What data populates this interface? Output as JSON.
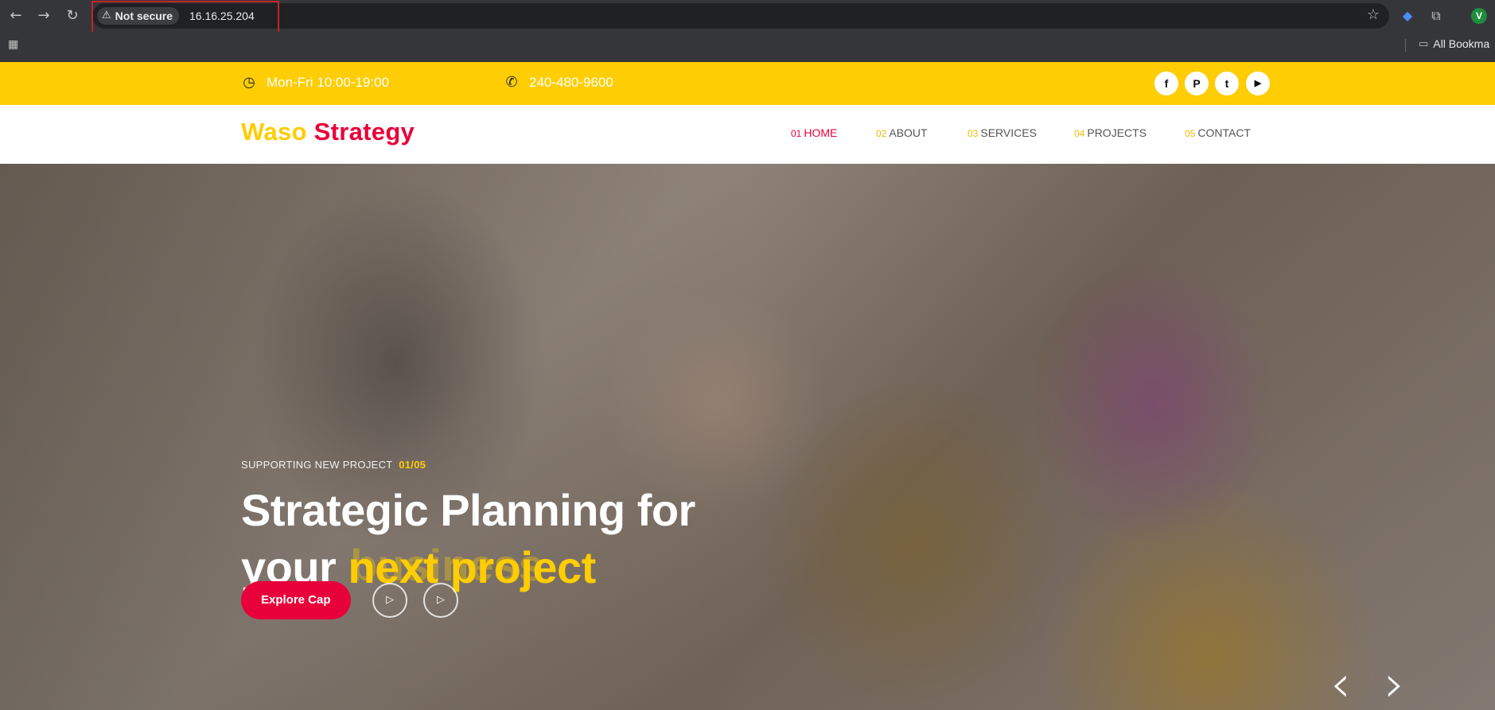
{
  "browser": {
    "security_label": "Not secure",
    "url": "16.16.25.204",
    "profile_initial": "V",
    "bookmarks_label": "All Bookma"
  },
  "topbar": {
    "hours": "Mon-Fri 10:00-19:00",
    "phone": "240-480-9600",
    "social": [
      {
        "name": "facebook-icon",
        "glyph": "f"
      },
      {
        "name": "pinterest-icon",
        "glyph": "P"
      },
      {
        "name": "twitter-icon",
        "glyph": "t"
      },
      {
        "name": "youtube-icon",
        "glyph": "▶"
      }
    ],
    "colors": {
      "background": "#fecd03"
    }
  },
  "header": {
    "logo_part1": "Waso",
    "logo_part2": "Strategy",
    "menu": [
      {
        "num": "01",
        "label": "HOME",
        "active": true
      },
      {
        "num": "02",
        "label": "ABOUT",
        "active": false
      },
      {
        "num": "03",
        "label": "SERVICES",
        "active": false
      },
      {
        "num": "04",
        "label": "PROJECTS",
        "active": false
      },
      {
        "num": "05",
        "label": "CONTACT",
        "active": false
      }
    ]
  },
  "hero": {
    "kicker": "SUPPORTING NEW PROJECT",
    "counter": "01/05",
    "title_line1": "Strategic Planning for",
    "title_line2_a": "your ",
    "title_line2_b": "next project",
    "ghost_text": "business",
    "cta_label": "Explore Cap",
    "colors": {
      "accent": "#e8003a",
      "highlight": "#fecd03"
    }
  }
}
